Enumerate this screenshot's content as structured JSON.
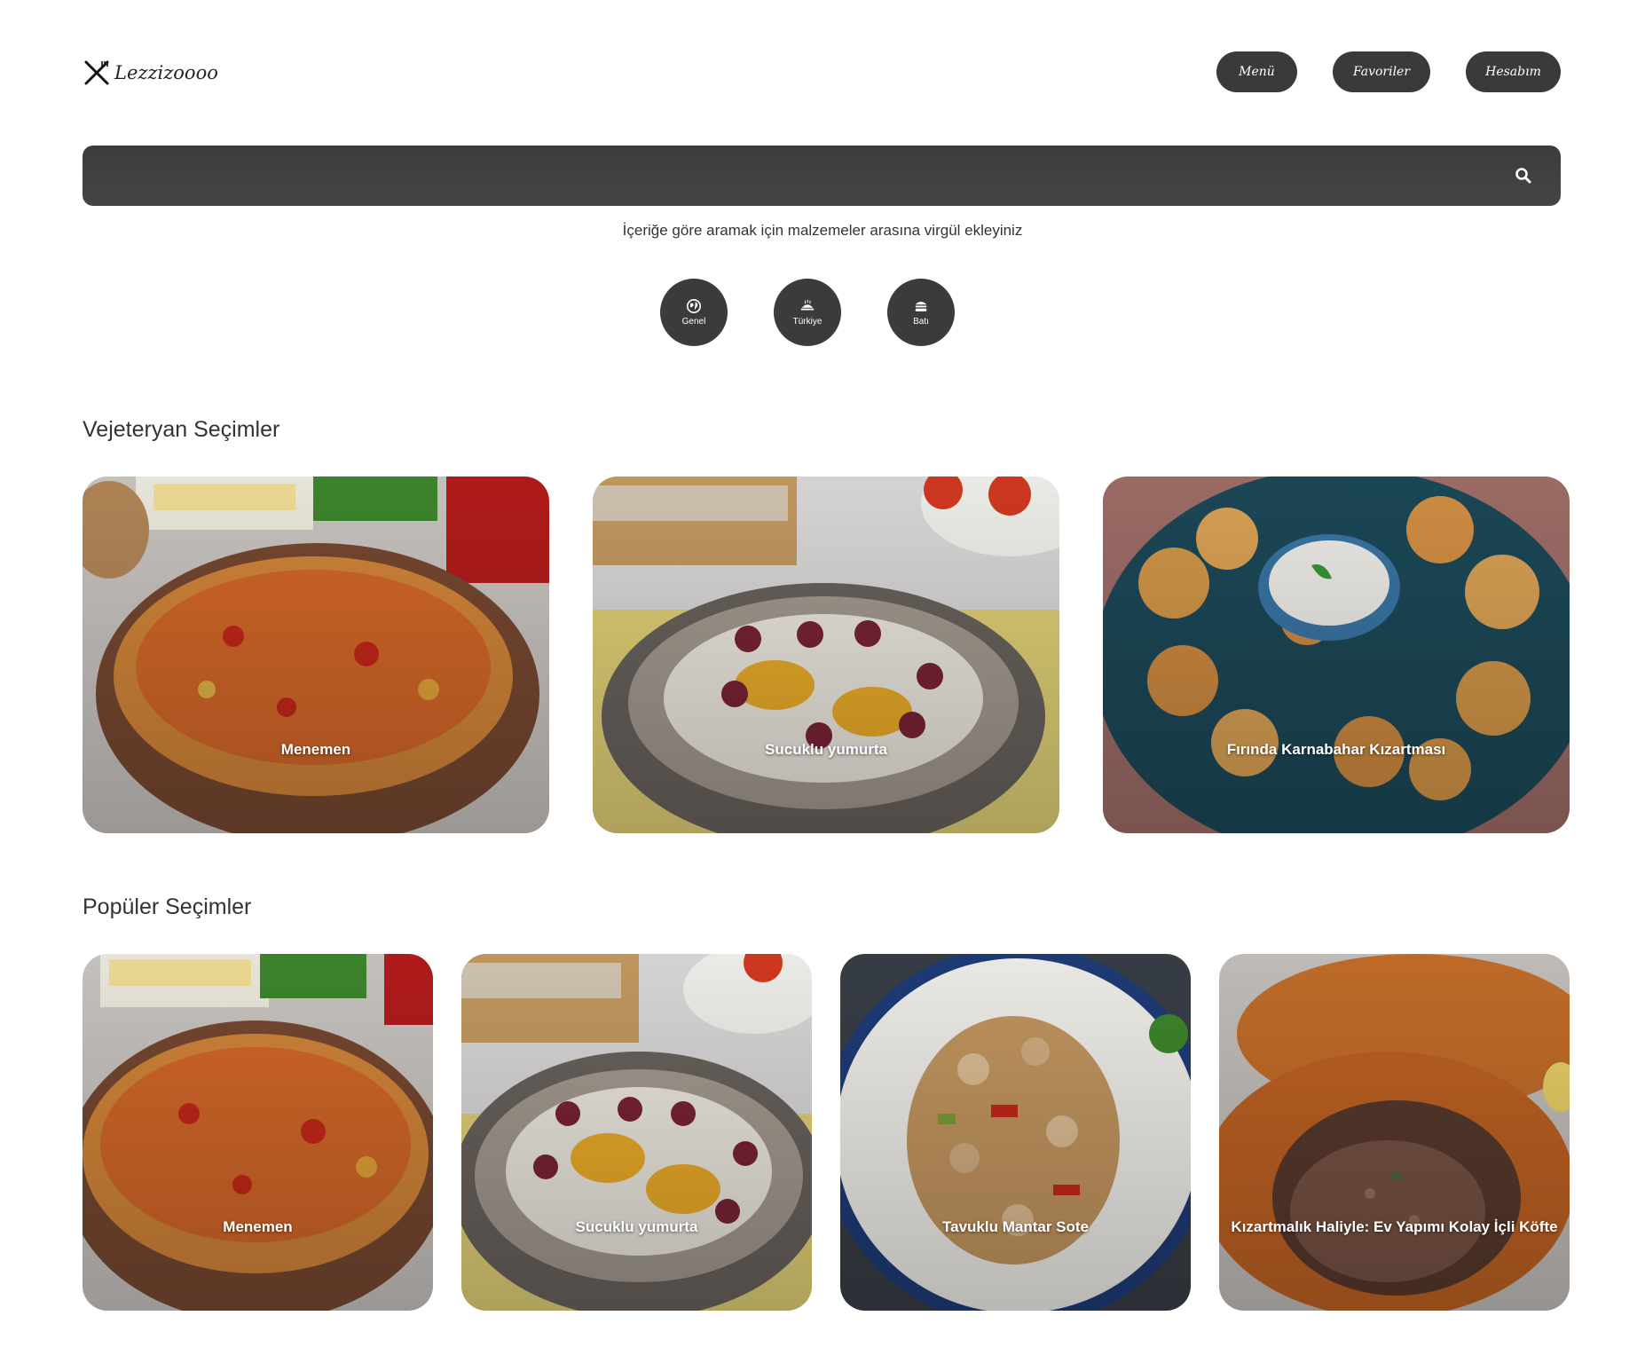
{
  "header": {
    "logo_text": "Lezzizoooo",
    "nav": [
      {
        "label": "Menü"
      },
      {
        "label": "Favoriler"
      },
      {
        "label": "Hesabım"
      }
    ]
  },
  "search": {
    "placeholder": "",
    "hint": "İçeriğe göre aramak için malzemeler arasına virgül ekleyiniz"
  },
  "categories": [
    {
      "label": "Genel",
      "icon": "globe-icon"
    },
    {
      "label": "Türkiye",
      "icon": "turkey-food-icon"
    },
    {
      "label": "Batı",
      "icon": "burger-icon"
    }
  ],
  "sections": {
    "vegetarian": {
      "title": "Vejeteryan Seçimler",
      "cards": [
        {
          "label": "Menemen"
        },
        {
          "label": "Sucuklu yumurta"
        },
        {
          "label": "Fırında Karnabahar Kızartması"
        }
      ]
    },
    "popular": {
      "title": "Popüler Seçimler",
      "cards": [
        {
          "label": "Menemen"
        },
        {
          "label": "Sucuklu yumurta"
        },
        {
          "label": "Tavuklu Mantar Sote"
        },
        {
          "label": "Kızartmalık Haliyle: Ev Yapımı Kolay İçli Köfte"
        }
      ]
    }
  }
}
